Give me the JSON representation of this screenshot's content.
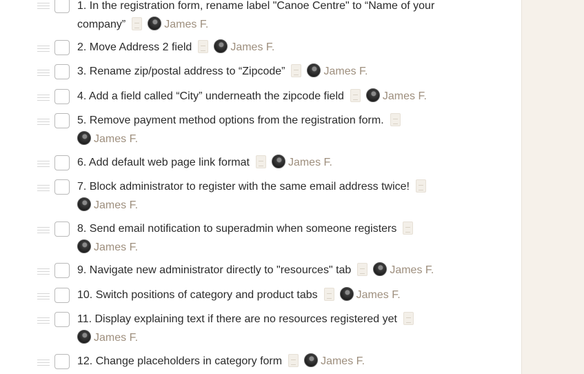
{
  "todos": [
    {
      "text": "1. In the registration form, rename label \"Canoe Centre\" to “Name of your company”",
      "assignee": "James F."
    },
    {
      "text": "2. Move Address 2 field",
      "assignee": "James F."
    },
    {
      "text": "3. Rename zip/postal address to “Zipcode”",
      "assignee": "James F."
    },
    {
      "text": "4. Add a field called “City” underneath the zipcode field",
      "assignee": "James F."
    },
    {
      "text": "5. Remove payment method options from the registration form.",
      "assignee": "James F."
    },
    {
      "text": "6. Add default web page link format",
      "assignee": "James F."
    },
    {
      "text": "7. Block administrator to register with the same email address twice!",
      "assignee": "James F."
    },
    {
      "text": "8. Send email notification to superadmin when someone registers",
      "assignee": "James F."
    },
    {
      "text": "9. Navigate new administrator directly to \"resources\" tab",
      "assignee": "James F."
    },
    {
      "text": "10. Switch positions of category and product tabs",
      "assignee": "James F."
    },
    {
      "text": "11. Display explaining text if there are no resources registered yet",
      "assignee": "James F."
    },
    {
      "text": "12. Change placeholders in category form",
      "assignee": "James F."
    }
  ]
}
